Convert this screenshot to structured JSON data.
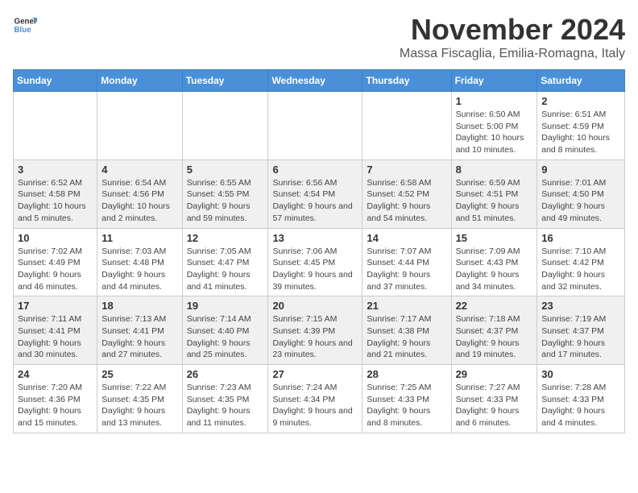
{
  "header": {
    "logo_general": "General",
    "logo_blue": "Blue",
    "month_title": "November 2024",
    "location": "Massa Fiscaglia, Emilia-Romagna, Italy"
  },
  "weekdays": [
    "Sunday",
    "Monday",
    "Tuesday",
    "Wednesday",
    "Thursday",
    "Friday",
    "Saturday"
  ],
  "weeks": [
    [
      {
        "day": "",
        "info": ""
      },
      {
        "day": "",
        "info": ""
      },
      {
        "day": "",
        "info": ""
      },
      {
        "day": "",
        "info": ""
      },
      {
        "day": "",
        "info": ""
      },
      {
        "day": "1",
        "info": "Sunrise: 6:50 AM\nSunset: 5:00 PM\nDaylight: 10 hours and 10 minutes."
      },
      {
        "day": "2",
        "info": "Sunrise: 6:51 AM\nSunset: 4:59 PM\nDaylight: 10 hours and 8 minutes."
      }
    ],
    [
      {
        "day": "3",
        "info": "Sunrise: 6:52 AM\nSunset: 4:58 PM\nDaylight: 10 hours and 5 minutes."
      },
      {
        "day": "4",
        "info": "Sunrise: 6:54 AM\nSunset: 4:56 PM\nDaylight: 10 hours and 2 minutes."
      },
      {
        "day": "5",
        "info": "Sunrise: 6:55 AM\nSunset: 4:55 PM\nDaylight: 9 hours and 59 minutes."
      },
      {
        "day": "6",
        "info": "Sunrise: 6:56 AM\nSunset: 4:54 PM\nDaylight: 9 hours and 57 minutes."
      },
      {
        "day": "7",
        "info": "Sunrise: 6:58 AM\nSunset: 4:52 PM\nDaylight: 9 hours and 54 minutes."
      },
      {
        "day": "8",
        "info": "Sunrise: 6:59 AM\nSunset: 4:51 PM\nDaylight: 9 hours and 51 minutes."
      },
      {
        "day": "9",
        "info": "Sunrise: 7:01 AM\nSunset: 4:50 PM\nDaylight: 9 hours and 49 minutes."
      }
    ],
    [
      {
        "day": "10",
        "info": "Sunrise: 7:02 AM\nSunset: 4:49 PM\nDaylight: 9 hours and 46 minutes."
      },
      {
        "day": "11",
        "info": "Sunrise: 7:03 AM\nSunset: 4:48 PM\nDaylight: 9 hours and 44 minutes."
      },
      {
        "day": "12",
        "info": "Sunrise: 7:05 AM\nSunset: 4:47 PM\nDaylight: 9 hours and 41 minutes."
      },
      {
        "day": "13",
        "info": "Sunrise: 7:06 AM\nSunset: 4:45 PM\nDaylight: 9 hours and 39 minutes."
      },
      {
        "day": "14",
        "info": "Sunrise: 7:07 AM\nSunset: 4:44 PM\nDaylight: 9 hours and 37 minutes."
      },
      {
        "day": "15",
        "info": "Sunrise: 7:09 AM\nSunset: 4:43 PM\nDaylight: 9 hours and 34 minutes."
      },
      {
        "day": "16",
        "info": "Sunrise: 7:10 AM\nSunset: 4:42 PM\nDaylight: 9 hours and 32 minutes."
      }
    ],
    [
      {
        "day": "17",
        "info": "Sunrise: 7:11 AM\nSunset: 4:41 PM\nDaylight: 9 hours and 30 minutes."
      },
      {
        "day": "18",
        "info": "Sunrise: 7:13 AM\nSunset: 4:41 PM\nDaylight: 9 hours and 27 minutes."
      },
      {
        "day": "19",
        "info": "Sunrise: 7:14 AM\nSunset: 4:40 PM\nDaylight: 9 hours and 25 minutes."
      },
      {
        "day": "20",
        "info": "Sunrise: 7:15 AM\nSunset: 4:39 PM\nDaylight: 9 hours and 23 minutes."
      },
      {
        "day": "21",
        "info": "Sunrise: 7:17 AM\nSunset: 4:38 PM\nDaylight: 9 hours and 21 minutes."
      },
      {
        "day": "22",
        "info": "Sunrise: 7:18 AM\nSunset: 4:37 PM\nDaylight: 9 hours and 19 minutes."
      },
      {
        "day": "23",
        "info": "Sunrise: 7:19 AM\nSunset: 4:37 PM\nDaylight: 9 hours and 17 minutes."
      }
    ],
    [
      {
        "day": "24",
        "info": "Sunrise: 7:20 AM\nSunset: 4:36 PM\nDaylight: 9 hours and 15 minutes."
      },
      {
        "day": "25",
        "info": "Sunrise: 7:22 AM\nSunset: 4:35 PM\nDaylight: 9 hours and 13 minutes."
      },
      {
        "day": "26",
        "info": "Sunrise: 7:23 AM\nSunset: 4:35 PM\nDaylight: 9 hours and 11 minutes."
      },
      {
        "day": "27",
        "info": "Sunrise: 7:24 AM\nSunset: 4:34 PM\nDaylight: 9 hours and 9 minutes."
      },
      {
        "day": "28",
        "info": "Sunrise: 7:25 AM\nSunset: 4:33 PM\nDaylight: 9 hours and 8 minutes."
      },
      {
        "day": "29",
        "info": "Sunrise: 7:27 AM\nSunset: 4:33 PM\nDaylight: 9 hours and 6 minutes."
      },
      {
        "day": "30",
        "info": "Sunrise: 7:28 AM\nSunset: 4:33 PM\nDaylight: 9 hours and 4 minutes."
      }
    ]
  ]
}
